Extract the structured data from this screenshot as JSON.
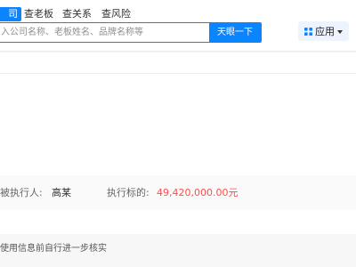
{
  "header": {
    "tabs": [
      {
        "label": "司",
        "active": true
      },
      {
        "label": "查老板",
        "active": false
      },
      {
        "label": "查关系",
        "active": false
      },
      {
        "label": "查风险",
        "active": false
      }
    ],
    "search": {
      "placeholder": "入公司名称、老板姓名、品牌名称等",
      "button_label": "天眼一下"
    },
    "apps_button": {
      "label": "应用",
      "icon": "grid-icon",
      "caret": "chevron-down-icon"
    }
  },
  "executor": {
    "label": "被执行人:",
    "value": "高某",
    "amount_label": "执行标的:",
    "amount_value": "49,420,000.00元"
  },
  "notice": {
    "text": "使用信息前自行进一步核实"
  },
  "colors": {
    "accent": "#0a84ff",
    "amount": "#ff4c4c",
    "apps_background": "#edf3ff"
  }
}
